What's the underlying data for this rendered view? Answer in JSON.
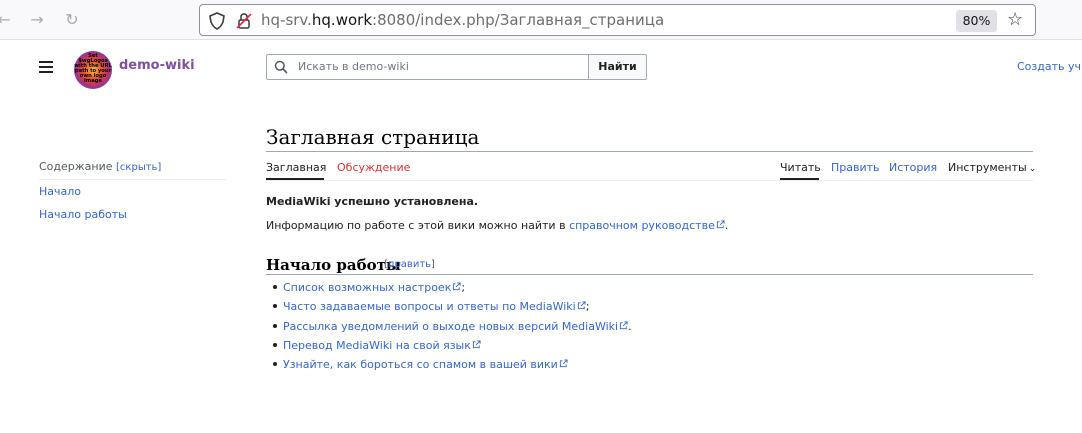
{
  "browser": {
    "url_prefix": "hq-srv.",
    "url_host": "hq.work",
    "url_suffix": ":8080/index.php/Заглавная_страница",
    "zoom": "80%"
  },
  "header": {
    "site_name": "demo-wiki",
    "logo_text": "Set $wgLogos with the URL path to your own logo image",
    "search_placeholder": "Искать в demo-wiki",
    "search_button": "Найти",
    "create_account": "Создать уч"
  },
  "toc": {
    "title": "Содержание",
    "hide": "[скрыть]",
    "items": [
      "Начало",
      "Начало работы"
    ]
  },
  "page": {
    "title": "Заглавная страница",
    "tabs_left": [
      "Заглавная",
      "Обсуждение"
    ],
    "tabs_right": [
      "Читать",
      "Править",
      "История",
      "Инструменты"
    ],
    "installed_msg": "MediaWiki успешно установлена.",
    "info_prefix": "Информацию по работе с этой вики можно найти в ",
    "info_link": "справочном руководстве",
    "info_suffix": "."
  },
  "section": {
    "title": "Начало работы",
    "edit_open": "[",
    "edit_label": "править",
    "edit_close": "]",
    "items": [
      {
        "text": "Список возможных настроек",
        "tail": ";"
      },
      {
        "text": "Часто задаваемые вопросы и ответы по MediaWiki",
        "tail": ";"
      },
      {
        "text": "Рассылка уведомлений о выходе новых версий MediaWiki",
        "tail": "."
      },
      {
        "text": "Перевод MediaWiki на свой язык",
        "tail": ""
      },
      {
        "text": "Узнайте, как бороться со спамом в вашей вики",
        "tail": ""
      }
    ]
  },
  "colors": {
    "link": "#3366cc",
    "talk_link_red": "#d73333",
    "site_name": "#7e4f9e"
  }
}
